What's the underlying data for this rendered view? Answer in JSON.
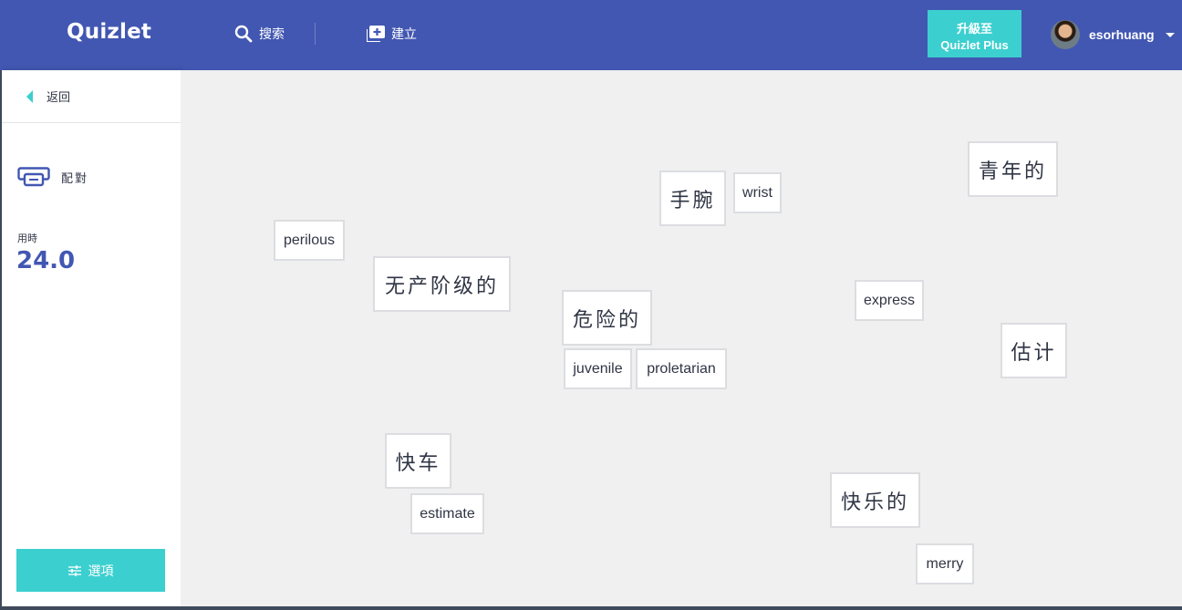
{
  "header": {
    "logo": "Quizlet",
    "search_label": "搜索",
    "create_label": "建立",
    "upgrade_line1": "升級至",
    "upgrade_line2": "Quizlet Plus",
    "username": "esorhuang"
  },
  "sidebar": {
    "back_label": "返回",
    "mode_label": "配對",
    "timer_label": "用時",
    "timer_value": "24.0",
    "options_label": "選項"
  },
  "tiles": [
    {
      "text": "perilous"
    },
    {
      "text": "无产阶级的"
    },
    {
      "text": "手腕"
    },
    {
      "text": "wrist"
    },
    {
      "text": "危险的"
    },
    {
      "text": "juvenile"
    },
    {
      "text": "proletarian"
    },
    {
      "text": "青年的"
    },
    {
      "text": "express"
    },
    {
      "text": "估计"
    },
    {
      "text": "快车"
    },
    {
      "text": "estimate"
    },
    {
      "text": "快乐的"
    },
    {
      "text": "merry"
    }
  ],
  "colors": {
    "brand": "#4257b2",
    "accent": "#3ccfcf",
    "board": "#f0f0f0"
  }
}
